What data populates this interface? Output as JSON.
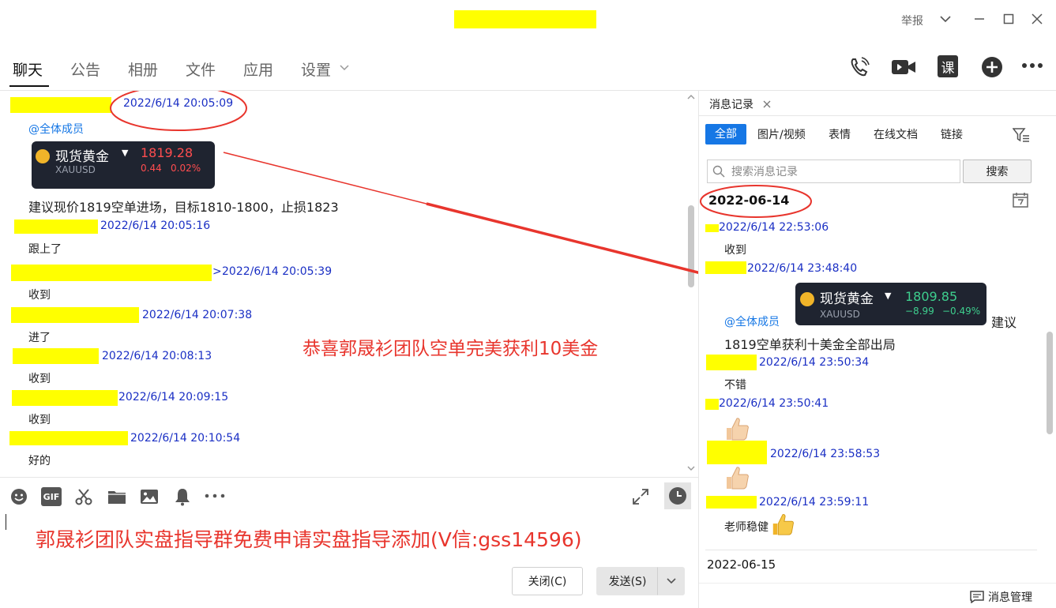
{
  "window": {
    "report": "举报"
  },
  "tabs": [
    {
      "label": "聊天"
    },
    {
      "label": "公告"
    },
    {
      "label": "相册"
    },
    {
      "label": "文件"
    },
    {
      "label": "应用"
    },
    {
      "label": "设置"
    }
  ],
  "chat": {
    "messages": [
      {
        "time": "2022/6/14 20:05:09",
        "mention": "@全体成员",
        "text": "建议现价1819空单进场，目标1810-1800，止损1823"
      },
      {
        "time": "2022/6/14 20:05:16",
        "text": "跟上了"
      },
      {
        "time": "2022/6/14 20:05:39",
        "prefix": ">",
        "text": "收到"
      },
      {
        "time": "2022/6/14 20:07:38",
        "text": "进了"
      },
      {
        "time": "2022/6/14 20:08:13",
        "text": "收到"
      },
      {
        "time": "2022/6/14 20:09:15",
        "text": "收到"
      },
      {
        "time": "2022/6/14 20:10:54",
        "text": "好的"
      }
    ],
    "card1": {
      "name": "现货黄金",
      "symbol": "XAUUSD",
      "price": "1819.28",
      "change": "0.44",
      "pct": "0.02%"
    },
    "annotation": "恭喜郭晟衫团队空单完美获利10美金"
  },
  "input": {
    "text": "郭晟衫团队实盘指导群免费申请实盘指导添加(V信:gss14596)",
    "close_label": "关闭(C)",
    "send_label": "发送(S)"
  },
  "history": {
    "tab_label": "消息记录",
    "filters": [
      "全部",
      "图片/视频",
      "表情",
      "在线文档",
      "链接"
    ],
    "search_placeholder": "搜索消息记录",
    "search_button": "搜索",
    "date1": "2022-06-14",
    "date2": "2022-06-15",
    "entries": [
      {
        "time": "2022/6/14 22:53:06",
        "text": "收到"
      },
      {
        "time": "2022/6/14 23:48:40",
        "mention": "@全体成员",
        "text_suffix": "建议",
        "text": "1819空单获利十美金全部出局"
      },
      {
        "time": "2022/6/14 23:50:34",
        "text": "不错"
      },
      {
        "time": "2022/6/14 23:50:41"
      },
      {
        "time": "2022/6/14 23:58:53"
      },
      {
        "time": "2022/6/14 23:59:11",
        "text": "老师稳健"
      }
    ],
    "card2": {
      "name": "现货黄金",
      "symbol": "XAUUSD",
      "price": "1809.85",
      "change": "−8.99",
      "pct": "−0.49%"
    },
    "manage_label": "消息管理"
  },
  "colors": {
    "accent": "#1677e5",
    "timestamp": "#1a2fc4",
    "highlight": "#ffff00",
    "annotation_red": "#e8352d",
    "card_bg": "#1f2430"
  }
}
